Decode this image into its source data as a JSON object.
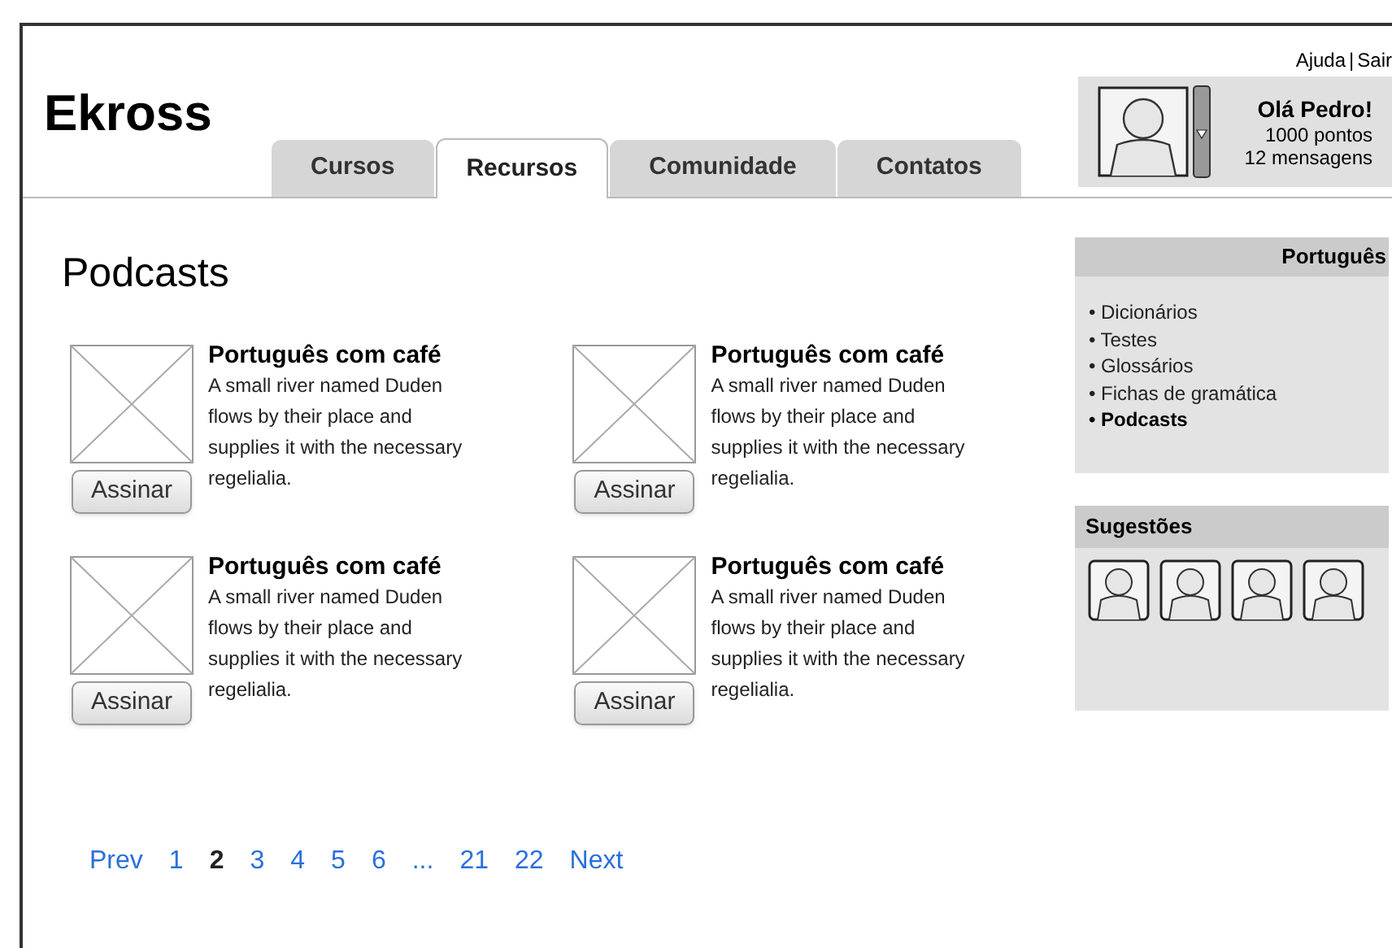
{
  "logo": "Ekross",
  "tabs": [
    {
      "label": "Cursos",
      "selected": false
    },
    {
      "label": "Recursos",
      "selected": true
    },
    {
      "label": "Comunidade",
      "selected": false
    },
    {
      "label": "Contatos",
      "selected": false
    }
  ],
  "top_links": [
    "Ajuda",
    "|",
    "Sair"
  ],
  "user": {
    "greeting": "Olá Pedro!",
    "points": "1000 pontos",
    "messages": "12 mensagens"
  },
  "page_title": "Podcasts",
  "podcasts": [
    {
      "title": "Português com café",
      "description": "A small river named Duden flows by their place and supplies it with the necessary regelialia.",
      "button": "Assinar"
    },
    {
      "title": "Português com café",
      "description": "A small river named Duden flows by their place and supplies it with the necessary regelialia.",
      "button": "Assinar"
    },
    {
      "title": "Português com café",
      "description": "A small river named Duden flows by their place and supplies it with the necessary regelialia.",
      "button": "Assinar"
    },
    {
      "title": "Português com café",
      "description": "A small river named Duden flows by their place and supplies it with the necessary regelialia.",
      "button": "Assinar"
    }
  ],
  "pagination": [
    {
      "label": "Prev",
      "selected": false
    },
    {
      "label": "1",
      "selected": false
    },
    {
      "label": "2",
      "selected": true
    },
    {
      "label": "3",
      "selected": false
    },
    {
      "label": "4",
      "selected": false
    },
    {
      "label": "5",
      "selected": false
    },
    {
      "label": "6",
      "selected": false
    },
    {
      "label": "...",
      "selected": false
    },
    {
      "label": "21",
      "selected": false
    },
    {
      "label": "22",
      "selected": false
    },
    {
      "label": "Next",
      "selected": false
    }
  ],
  "sidebar": {
    "title": "Português",
    "items": [
      {
        "label": "• Dicionários",
        "selected": false
      },
      {
        "label": "• Testes",
        "selected": false
      },
      {
        "label": "• Glossários",
        "selected": false
      },
      {
        "label": "• Fichas de gramática",
        "selected": false
      },
      {
        "label": "• Podcasts",
        "selected": true
      }
    ]
  },
  "suggestions": {
    "title": "Sugestões",
    "people": [
      {
        "kind": "avatar"
      },
      {
        "kind": "avatar"
      },
      {
        "kind": "avatar"
      },
      {
        "kind": "avatar"
      }
    ]
  }
}
